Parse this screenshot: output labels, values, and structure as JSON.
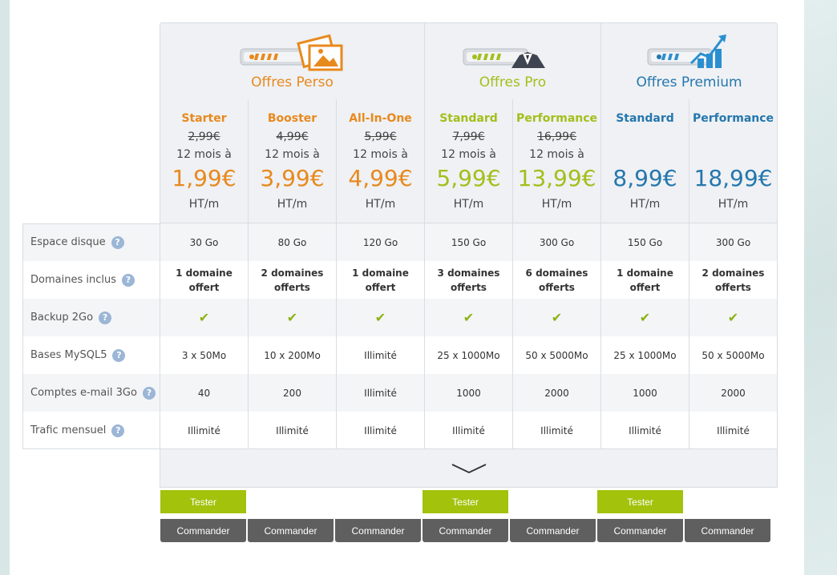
{
  "groups": [
    {
      "key": "perso",
      "title": "Offres Perso",
      "color": "#e8891d"
    },
    {
      "key": "pro",
      "title": "Offres Pro",
      "color": "#a2bf1a"
    },
    {
      "key": "premium",
      "title": "Offres Premium",
      "color": "#2577ad"
    }
  ],
  "plans": [
    {
      "name": "Starter",
      "old_price": "2,99€",
      "duration": "12 mois à",
      "price": "1,99€",
      "unit": "HT/m",
      "group": "perso"
    },
    {
      "name": "Booster",
      "old_price": "4,99€",
      "duration": "12 mois à",
      "price": "3,99€",
      "unit": "HT/m",
      "group": "perso"
    },
    {
      "name": "All-In-One",
      "old_price": "5,99€",
      "duration": "12 mois à",
      "price": "4,99€",
      "unit": "HT/m",
      "group": "perso"
    },
    {
      "name": "Standard",
      "old_price": "7,99€",
      "duration": "12 mois à",
      "price": "5,99€",
      "unit": "HT/m",
      "group": "pro"
    },
    {
      "name": "Performance",
      "old_price": "16,99€",
      "duration": "12 mois à",
      "price": "13,99€",
      "unit": "HT/m",
      "group": "pro"
    },
    {
      "name": "Standard",
      "old_price": "",
      "duration": "",
      "price": "8,99€",
      "unit": "HT/m",
      "group": "premium"
    },
    {
      "name": "Performance",
      "old_price": "",
      "duration": "",
      "price": "18,99€",
      "unit": "HT/m",
      "group": "premium"
    }
  ],
  "features": [
    {
      "label": "Espace disque",
      "help": "?",
      "values": [
        "30 Go",
        "80 Go",
        "120 Go",
        "150 Go",
        "300 Go",
        "150 Go",
        "300 Go"
      ]
    },
    {
      "label": "Domaines inclus",
      "help": "?",
      "values": [
        "1 domaine offert",
        "2 domaines offerts",
        "1 domaine offert",
        "3 domaines offerts",
        "6 domaines offerts",
        "1 domaine offert",
        "2 domaines offerts"
      ]
    },
    {
      "label": "Backup 2Go",
      "help": "?",
      "values": [
        "✔",
        "✔",
        "✔",
        "✔",
        "✔",
        "✔",
        "✔"
      ]
    },
    {
      "label": "Bases MySQL5",
      "help": "?",
      "values": [
        "3 x 50Mo",
        "10 x 200Mo",
        "Illimité",
        "25 x 1000Mo",
        "50 x 5000Mo",
        "25 x 1000Mo",
        "50 x 5000Mo"
      ]
    },
    {
      "label": "Comptes e-mail 3Go",
      "help": "?",
      "values": [
        "40",
        "200",
        "Illimité",
        "1000",
        "2000",
        "1000",
        "2000"
      ]
    },
    {
      "label": "Trafic mensuel",
      "help": "?",
      "values": [
        "Illimité",
        "Illimité",
        "Illimité",
        "Illimité",
        "Illimité",
        "Illimité",
        "Illimité"
      ]
    }
  ],
  "buttons": {
    "test_label": "Tester",
    "order_label": "Commander"
  },
  "expand_icon": "chevron-down-icon"
}
